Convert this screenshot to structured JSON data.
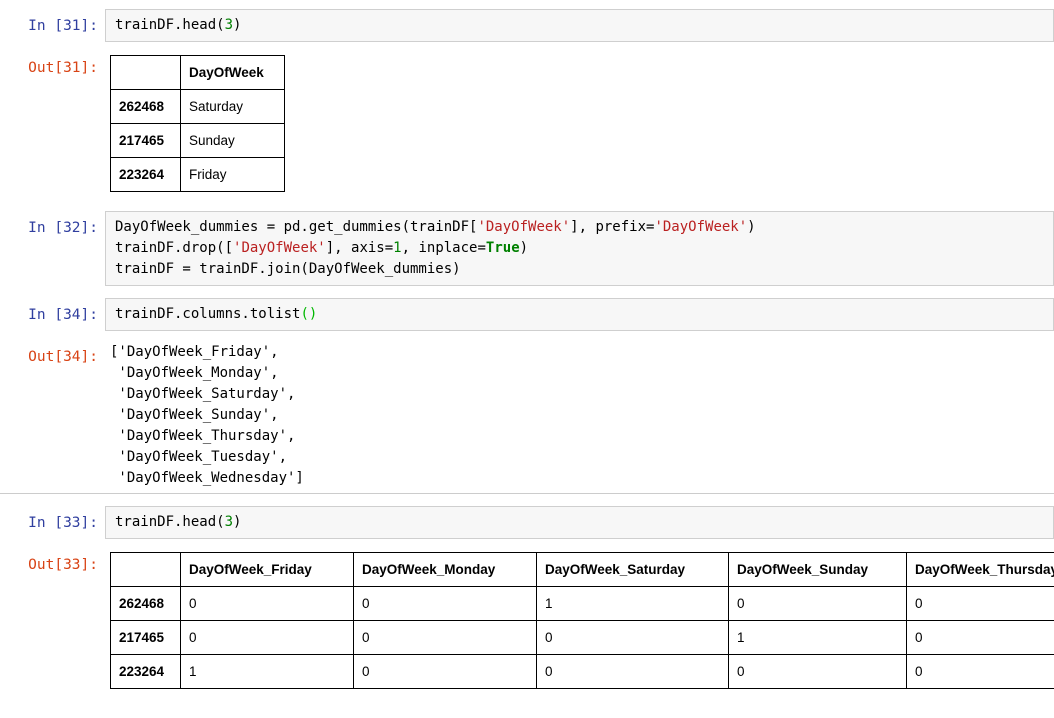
{
  "colors": {
    "in_prompt": "#303F9F",
    "out_prompt": "#D84315",
    "code_bg": "#f7f7f7",
    "code_border": "#cfcfcf",
    "string": "#BA2121",
    "number": "#008000",
    "keyword": "#008000",
    "bracket": "#00B800",
    "table_border": "#000000"
  },
  "cells": {
    "in31": {
      "prompt": "In [31]:",
      "lines": [
        [
          {
            "t": "trainDF.head("
          },
          {
            "t": "3",
            "c": "n"
          },
          {
            "t": ")"
          }
        ]
      ]
    },
    "out31": {
      "prompt": "Out[31]:",
      "table": {
        "headers": [
          "",
          "DayOfWeek"
        ],
        "rows": [
          [
            "262468",
            "Saturday"
          ],
          [
            "217465",
            "Sunday"
          ],
          [
            "223264",
            "Friday"
          ]
        ]
      }
    },
    "in32": {
      "prompt": "In [32]:",
      "lines": [
        [
          {
            "t": "DayOfWeek_dummies = pd.get_dummies(trainDF["
          },
          {
            "t": "'DayOfWeek'",
            "c": "s"
          },
          {
            "t": "], prefix="
          },
          {
            "t": "'DayOfWeek'",
            "c": "s"
          },
          {
            "t": ")"
          }
        ],
        [
          {
            "t": "trainDF.drop(["
          },
          {
            "t": "'DayOfWeek'",
            "c": "s"
          },
          {
            "t": "], axis="
          },
          {
            "t": "1",
            "c": "n"
          },
          {
            "t": ", inplace="
          },
          {
            "t": "True",
            "c": "k"
          },
          {
            "t": ")"
          }
        ],
        [
          {
            "t": "trainDF = trainDF.join(DayOfWeek_dummies)"
          }
        ]
      ]
    },
    "in34": {
      "prompt": "In [34]:",
      "lines": [
        [
          {
            "t": "trainDF.columns.tolist"
          },
          {
            "t": "()",
            "c": "b"
          }
        ]
      ]
    },
    "out34": {
      "prompt": "Out[34]:",
      "lines": [
        "['DayOfWeek_Friday',",
        " 'DayOfWeek_Monday',",
        " 'DayOfWeek_Saturday',",
        " 'DayOfWeek_Sunday',",
        " 'DayOfWeek_Thursday',",
        " 'DayOfWeek_Tuesday',",
        " 'DayOfWeek_Wednesday']"
      ]
    },
    "in33": {
      "prompt": "In [33]:",
      "lines": [
        [
          {
            "t": "trainDF.head("
          },
          {
            "t": "3",
            "c": "n"
          },
          {
            "t": ")"
          }
        ]
      ]
    },
    "out33": {
      "prompt": "Out[33]:",
      "table": {
        "headers": [
          "",
          "DayOfWeek_Friday",
          "DayOfWeek_Monday",
          "DayOfWeek_Saturday",
          "DayOfWeek_Sunday",
          "DayOfWeek_Thursday"
        ],
        "rows": [
          [
            "262468",
            "0",
            "0",
            "1",
            "0",
            "0"
          ],
          [
            "217465",
            "0",
            "0",
            "0",
            "1",
            "0"
          ],
          [
            "223264",
            "1",
            "0",
            "0",
            "0",
            "0"
          ]
        ]
      }
    }
  }
}
